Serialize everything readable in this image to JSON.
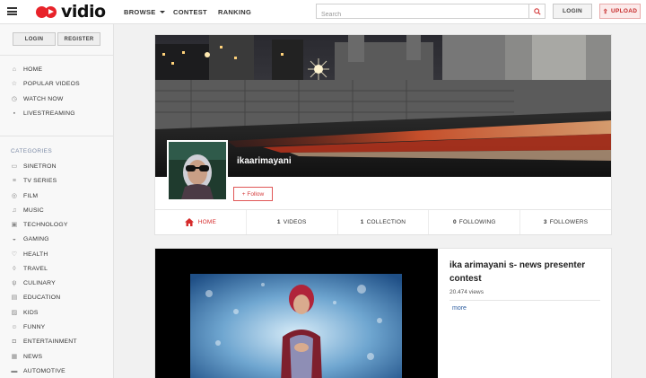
{
  "header": {
    "logo_text": "vidio",
    "nav": {
      "browse": "BROWSE",
      "contest": "CONTEST",
      "ranking": "RANKING"
    },
    "search_placeholder": "Search",
    "login": "LOGIN",
    "upload": "UPLOAD"
  },
  "sidebar": {
    "login": "LOGIN",
    "register": "REGISTER",
    "main_items": [
      {
        "label": "HOME",
        "icon": "home-icon"
      },
      {
        "label": "POPULAR VIDEOS",
        "icon": "star-icon"
      },
      {
        "label": "WATCH NOW",
        "icon": "clock-icon"
      },
      {
        "label": "LIVESTREAMING",
        "icon": "camera-icon"
      }
    ],
    "categories_title": "CATEGORIES",
    "categories": [
      {
        "label": "SINETRON",
        "icon": "tv-icon"
      },
      {
        "label": "TV SERIES",
        "icon": "list-icon"
      },
      {
        "label": "FILM",
        "icon": "film-icon"
      },
      {
        "label": "MUSIC",
        "icon": "music-icon"
      },
      {
        "label": "TECHNOLOGY",
        "icon": "chip-icon"
      },
      {
        "label": "GAMING",
        "icon": "gamepad-icon"
      },
      {
        "label": "HEALTH",
        "icon": "heart-icon"
      },
      {
        "label": "TRAVEL",
        "icon": "pin-icon"
      },
      {
        "label": "CULINARY",
        "icon": "fork-icon"
      },
      {
        "label": "EDUCATION",
        "icon": "book-icon"
      },
      {
        "label": "KIDS",
        "icon": "kids-icon"
      },
      {
        "label": "FUNNY",
        "icon": "smile-icon"
      },
      {
        "label": "ENTERTAINMENT",
        "icon": "ticket-icon"
      },
      {
        "label": "NEWS",
        "icon": "news-icon"
      },
      {
        "label": "AUTOMOTIVE",
        "icon": "car-icon"
      }
    ]
  },
  "profile": {
    "username": "ikaarimayani",
    "follow": "+ Follow",
    "tabs": {
      "home": "HOME",
      "videos_count": "1",
      "videos_label": "VIDEOS",
      "collection_count": "1",
      "collection_label": "COLLECTION",
      "following_count": "0",
      "following_label": "FOLLOWING",
      "followers_count": "3",
      "followers_label": "FOLLOWERS"
    }
  },
  "video": {
    "title": "ika arimayani s- news presenter contest",
    "views": "20.474 views",
    "more": "more"
  },
  "colors": {
    "accent": "#e8232a",
    "link": "#2d5d9f",
    "categories_title": "#7b8aa6"
  }
}
